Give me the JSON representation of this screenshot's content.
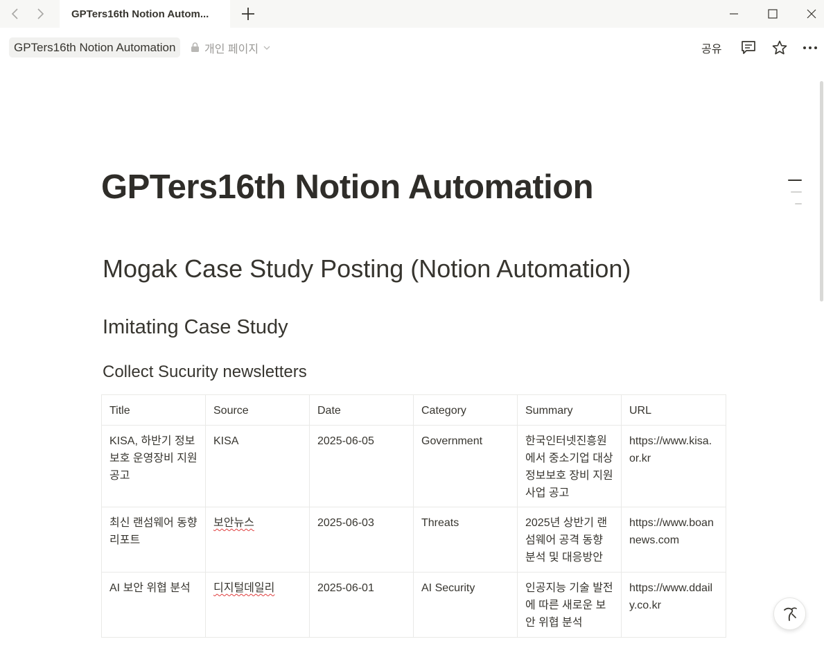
{
  "window": {
    "tab_title": "GPTers16th Notion Autom...",
    "icons": {
      "back": "chevron-left-icon",
      "forward": "chevron-right-icon",
      "new_tab": "plus-icon",
      "minimize": "minimize-icon",
      "maximize": "maximize-icon",
      "close": "close-icon"
    }
  },
  "topbar": {
    "breadcrumb": "GPTers16th Notion Automation",
    "privacy_label": "개인 페이지",
    "share_label": "공유",
    "icons": {
      "lock": "lock-icon",
      "dropdown": "chevron-down-icon",
      "comment": "comment-icon",
      "favorite": "star-icon",
      "more": "more-icon"
    }
  },
  "page": {
    "title": "GPTers16th Notion Automation",
    "heading1": "Mogak Case Study Posting (Notion Automation)",
    "heading2": "Imitating Case Study",
    "heading3": "Collect Sucurity newsletters"
  },
  "table": {
    "columns": [
      "Title",
      "Source",
      "Date",
      "Category",
      "Summary",
      "URL"
    ],
    "rows": [
      {
        "title": "KISA, 하반기 정보보호 운영장비 지원 공고",
        "source": "KISA",
        "date": "2025-06-05",
        "category": "Government",
        "summary": "한국인터넷진흥원에서 중소기업 대상 정보보호 장비 지원 사업 공고",
        "url": "https://www.kisa.or.kr"
      },
      {
        "title": "최신 랜섬웨어 동향 리포트",
        "source": "보안뉴스",
        "date": "2025-06-03",
        "category": "Threats",
        "summary": "2025년 상반기 랜섬웨어 공격 동향 분석 및 대응방안",
        "url": "https://www.boannews.com"
      },
      {
        "title": "AI 보안 위협 분석",
        "source": "디지털데일리",
        "date": "2025-06-01",
        "category": "AI Security",
        "summary": "인공지능 기술 발전에 따른 새로운 보안 위협 분석",
        "url": "https://www.ddaily.co.kr"
      }
    ]
  },
  "help": {
    "icon": "help-icon"
  },
  "colors": {
    "text": "#37352f",
    "muted": "#9b9a97",
    "titlebar_bg": "#f7f7f5",
    "border": "#e9e9e7",
    "spellcheck": "#e03e3e"
  }
}
